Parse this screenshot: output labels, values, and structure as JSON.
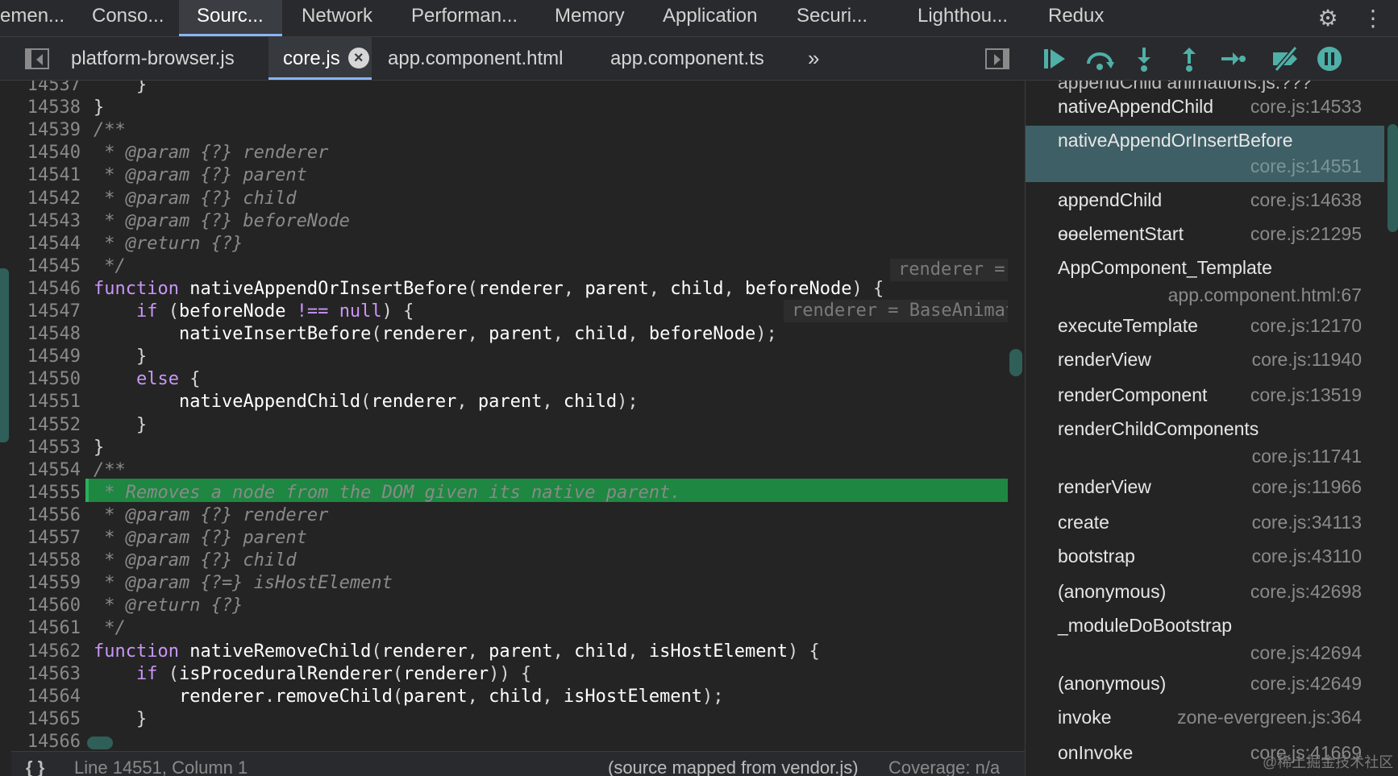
{
  "panel_tabs": [
    "emen...",
    "Conso...",
    "Sourc...",
    "Network",
    "Performan...",
    "Memory",
    "Application",
    "Securi...",
    "Lighthou...",
    "Redux"
  ],
  "active_panel_tab": "Sourc...",
  "file_tabs": [
    "platform-browser.js",
    "core.js",
    "app.component.html",
    "app.component.ts"
  ],
  "active_file_tab": "core.js",
  "more_tabs_glyph": "»",
  "editor": {
    "lines": [
      {
        "n": "14537",
        "html": "    <span class='pn'>}</span>"
      },
      {
        "n": "14538",
        "html": "<span class='pn'>}</span>"
      },
      {
        "n": "14539",
        "html": "<span class='cm'>/**</span>"
      },
      {
        "n": "14540",
        "html": "<span class='cm'> * @param {?} renderer</span>"
      },
      {
        "n": "14541",
        "html": "<span class='cm'> * @param {?} parent</span>"
      },
      {
        "n": "14542",
        "html": "<span class='cm'> * @param {?} child</span>"
      },
      {
        "n": "14543",
        "html": "<span class='cm'> * @param {?} beforeNode</span>"
      },
      {
        "n": "14544",
        "html": "<span class='cm'> * @return {?}</span>"
      },
      {
        "n": "14545",
        "html": "<span class='cm'> */</span>"
      },
      {
        "n": "14546",
        "html": "<span class='kw'>function</span> <span class='fn'>nativeAppendOrInsertBefore</span><span class='pn'>(</span><span class='id'>renderer</span><span class='pn'>, </span><span class='id'>parent</span><span class='pn'>, </span><span class='id'>child</span><span class='pn'>, </span><span class='id'>beforeNode</span><span class='pn'>) {</span>"
      },
      {
        "n": "14547",
        "html": "    <span class='kw'>if</span> <span class='pn'>(</span><span class='id'>beforeNode</span> <span class='kw'>!==</span> <span class='kw'>null</span><span class='pn'>) {</span>"
      },
      {
        "n": "14548",
        "html": "        <span class='fn'>nativeInsertBefore</span><span class='pn'>(</span><span class='id'>renderer</span><span class='pn'>, </span><span class='id'>parent</span><span class='pn'>, </span><span class='id'>child</span><span class='pn'>, </span><span class='id'>beforeNode</span><span class='pn'>);</span>"
      },
      {
        "n": "14549",
        "html": "    <span class='pn'>}</span>"
      },
      {
        "n": "14550",
        "html": "    <span class='kw'>else</span> <span class='pn'>{</span>"
      },
      {
        "n": "14551",
        "html": "        <span class='fn'>nativeAppendChild</span><span class='pn'>(</span><span class='id'>renderer</span><span class='pn'>, </span><span class='id'>parent</span><span class='pn'>, </span><span class='id'>child</span><span class='pn'>);</span>"
      },
      {
        "n": "14552",
        "html": "    <span class='pn'>}</span>"
      },
      {
        "n": "14553",
        "html": "<span class='pn'>}</span>"
      },
      {
        "n": "14554",
        "html": "<span class='cm'>/**</span>"
      },
      {
        "n": "14555",
        "html": "<span class='cm'> * Removes a node from the DOM given its native parent.</span>"
      },
      {
        "n": "14556",
        "html": "<span class='cm'> * @param {?} renderer</span>"
      },
      {
        "n": "14557",
        "html": "<span class='cm'> * @param {?} parent</span>"
      },
      {
        "n": "14558",
        "html": "<span class='cm'> * @param {?} child</span>"
      },
      {
        "n": "14559",
        "html": "<span class='cm'> * @param {?=} isHostElement</span>"
      },
      {
        "n": "14560",
        "html": "<span class='cm'> * @return {?}</span>"
      },
      {
        "n": "14561",
        "html": "<span class='cm'> */</span>"
      },
      {
        "n": "14562",
        "html": "<span class='kw'>function</span> <span class='fn'>nativeRemoveChild</span><span class='pn'>(</span><span class='id'>renderer</span><span class='pn'>, </span><span class='id'>parent</span><span class='pn'>, </span><span class='id'>child</span><span class='pn'>, </span><span class='id'>isHostElement</span><span class='pn'>) {</span>"
      },
      {
        "n": "14563",
        "html": "    <span class='kw'>if</span> <span class='pn'>(</span><span class='fn'>isProceduralRenderer</span><span class='pn'>(</span><span class='id'>renderer</span><span class='pn'>)) {</span>"
      },
      {
        "n": "14564",
        "html": "        <span class='id'>renderer</span><span class='pn'>.</span><span class='fn'>removeChild</span><span class='pn'>(</span><span class='id'>parent</span><span class='pn'>, </span><span class='id'>child</span><span class='pn'>, </span><span class='id'>isHostElement</span><span class='pn'>);</span>"
      },
      {
        "n": "14565",
        "html": "    <span class='pn'>}</span>"
      },
      {
        "n": "14566",
        "html": ""
      }
    ],
    "highlighted_line": "14551",
    "inline_values": [
      "renderer =",
      "renderer = BaseAnimat"
    ]
  },
  "status_bar": {
    "braces": "{ }",
    "position": "Line 14551, Column 1",
    "source_map": "(source mapped from vendor.js)",
    "coverage": "Coverage: n/a"
  },
  "call_stack": {
    "top_partial": "appendChild   animations.js:???",
    "frames": [
      {
        "name": "nativeAppendChild",
        "location": "core.js:14533"
      },
      {
        "name": "nativeAppendOrInsertBefore",
        "location": "core.js:14551",
        "active": true
      },
      {
        "name": "appendChild",
        "location": "core.js:14638"
      },
      {
        "name": "ɵɵelementStart",
        "location": "core.js:21295"
      },
      {
        "name": "AppComponent_Template",
        "location": "app.component.html:67"
      },
      {
        "name": "executeTemplate",
        "location": "core.js:12170"
      },
      {
        "name": "renderView",
        "location": "core.js:11940"
      },
      {
        "name": "renderComponent",
        "location": "core.js:13519"
      },
      {
        "name": "renderChildComponents",
        "location": "core.js:11741"
      },
      {
        "name": "renderView",
        "location": "core.js:11966"
      },
      {
        "name": "create",
        "location": "core.js:34113"
      },
      {
        "name": "bootstrap",
        "location": "core.js:43110"
      },
      {
        "name": "(anonymous)",
        "location": "core.js:42698"
      },
      {
        "name": "_moduleDoBootstrap",
        "location": "core.js:42694"
      },
      {
        "name": "(anonymous)",
        "location": "core.js:42649"
      },
      {
        "name": "invoke",
        "location": "zone-evergreen.js:364"
      },
      {
        "name": "onInvoke",
        "location": "core.js:41669"
      }
    ]
  },
  "watermark": "@稀土掘金技术社区",
  "colors": {
    "accent_teal": "#4fb0a8",
    "highlight_green": "#1e8741",
    "active_frame": "#3f5f66",
    "keyword": "#c996f7"
  },
  "icons": [
    "settings-gear-icon",
    "kebab-menu-icon",
    "toggle-navigator-icon",
    "toggle-debugger-icon",
    "resume-icon",
    "step-over-icon",
    "step-into-icon",
    "step-out-icon",
    "step-icon",
    "deactivate-breakpoints-icon",
    "pause-on-exceptions-icon",
    "more-tabs-icon"
  ]
}
